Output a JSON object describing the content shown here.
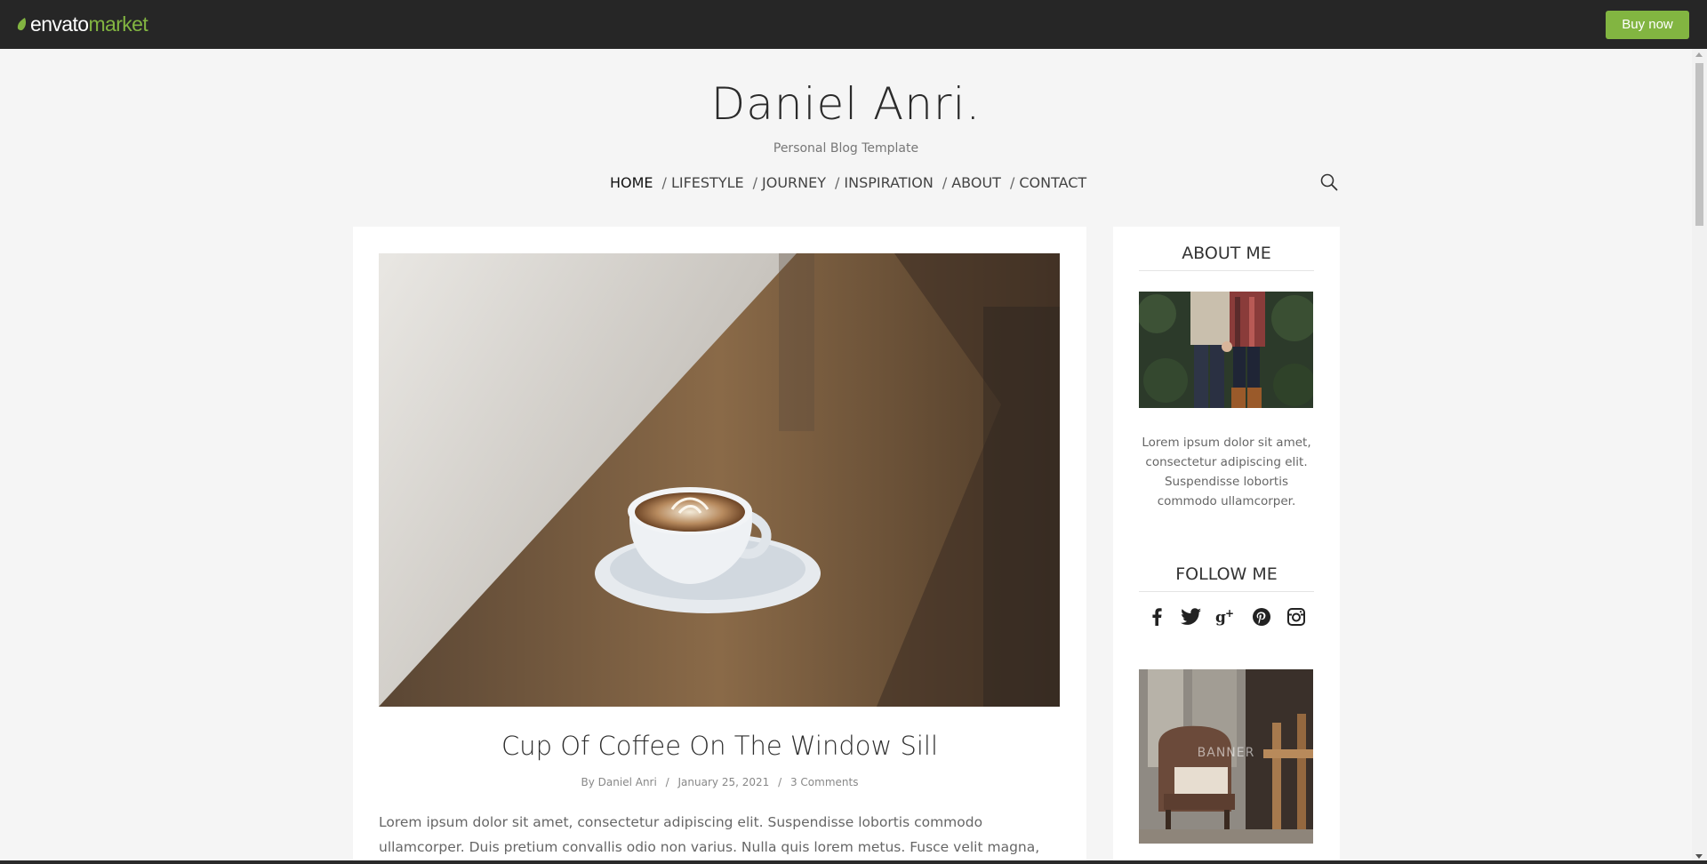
{
  "topbar": {
    "logo_envato": "envato",
    "logo_market": "market",
    "buy_label": "Buy now",
    "accent_color": "#82b541"
  },
  "header": {
    "site_title": "Daniel Anri.",
    "tagline": "Personal Blog Template"
  },
  "nav": {
    "items": [
      {
        "label": "HOME",
        "active": true
      },
      {
        "label": "LIFESTYLE"
      },
      {
        "label": "JOURNEY"
      },
      {
        "label": "INSPIRATION"
      },
      {
        "label": "ABOUT"
      },
      {
        "label": "CONTACT"
      }
    ],
    "separator": "/",
    "search_icon": "search-icon"
  },
  "post": {
    "title": "Cup Of Coffee On The Window Sill",
    "author": "By Daniel Anri",
    "date": "January 25, 2021",
    "comments": "3 Comments",
    "meta_separator": "/",
    "excerpt": "Lorem ipsum dolor sit amet, consectetur adipiscing elit. Suspendisse lobortis commodo ullamcorper. Duis pretium convallis odio non varius. Nulla quis lorem metus. Fusce velit magna, ultricies quis elit sit"
  },
  "sidebar": {
    "about_heading": "ABOUT ME",
    "about_text": "Lorem ipsum dolor sit amet, consectetur adipiscing elit. Suspendisse lobortis commodo ullamcorper.",
    "follow_heading": "FOLLOW ME",
    "social_icons": [
      "facebook-icon",
      "twitter-icon",
      "google-plus-icon",
      "pinterest-icon",
      "instagram-icon"
    ],
    "banner_label": "BANNER"
  }
}
